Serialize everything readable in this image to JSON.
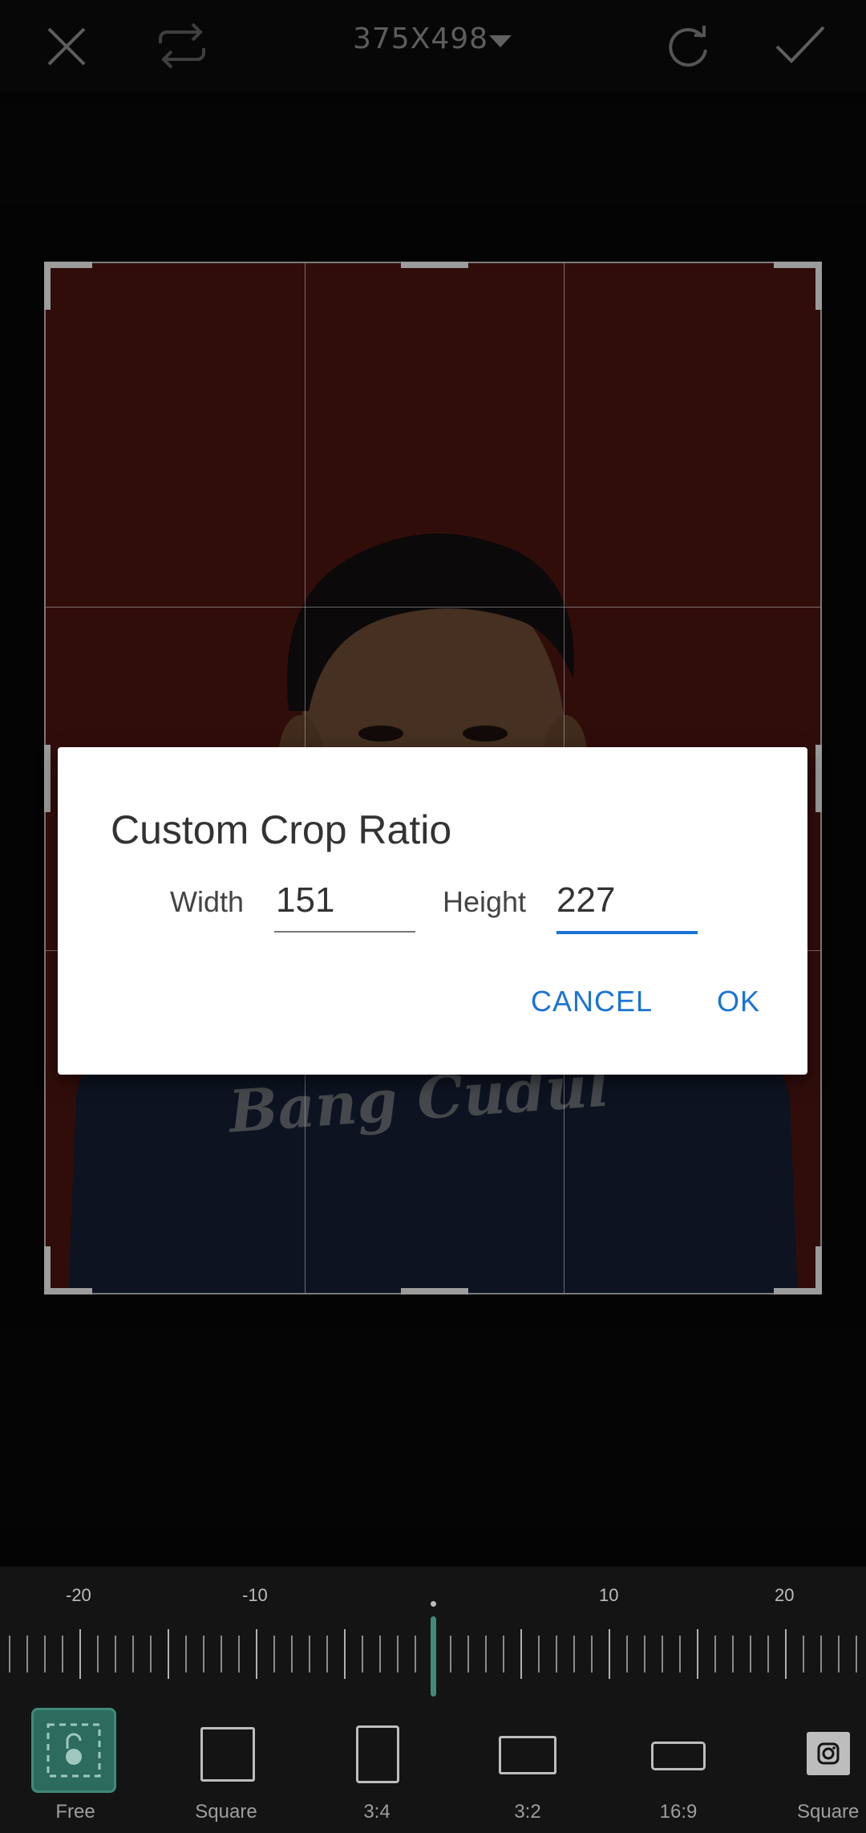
{
  "toolbar": {
    "dimensions": "375X498"
  },
  "dialog": {
    "title": "Custom Crop Ratio",
    "width_label": "Width",
    "width_value": "151",
    "height_label": "Height",
    "height_value": "227",
    "cancel_label": "CANCEL",
    "ok_label": "OK"
  },
  "photo": {
    "shirt_text": "Bang Cudul"
  },
  "ruler": {
    "labels": [
      "-20",
      "-10",
      "10",
      "20"
    ],
    "value": 0
  },
  "ratios": [
    {
      "label": "Free",
      "selected": true
    },
    {
      "label": "Square",
      "selected": false
    },
    {
      "label": "3:4",
      "selected": false
    },
    {
      "label": "3:2",
      "selected": false
    },
    {
      "label": "16:9",
      "selected": false
    },
    {
      "label": "Square",
      "selected": false,
      "icon": "instagram-icon"
    }
  ],
  "colors": {
    "accent": "#1a73d4",
    "selected_tool": "#2c6b5e",
    "backdrop": "#6e1e18"
  }
}
